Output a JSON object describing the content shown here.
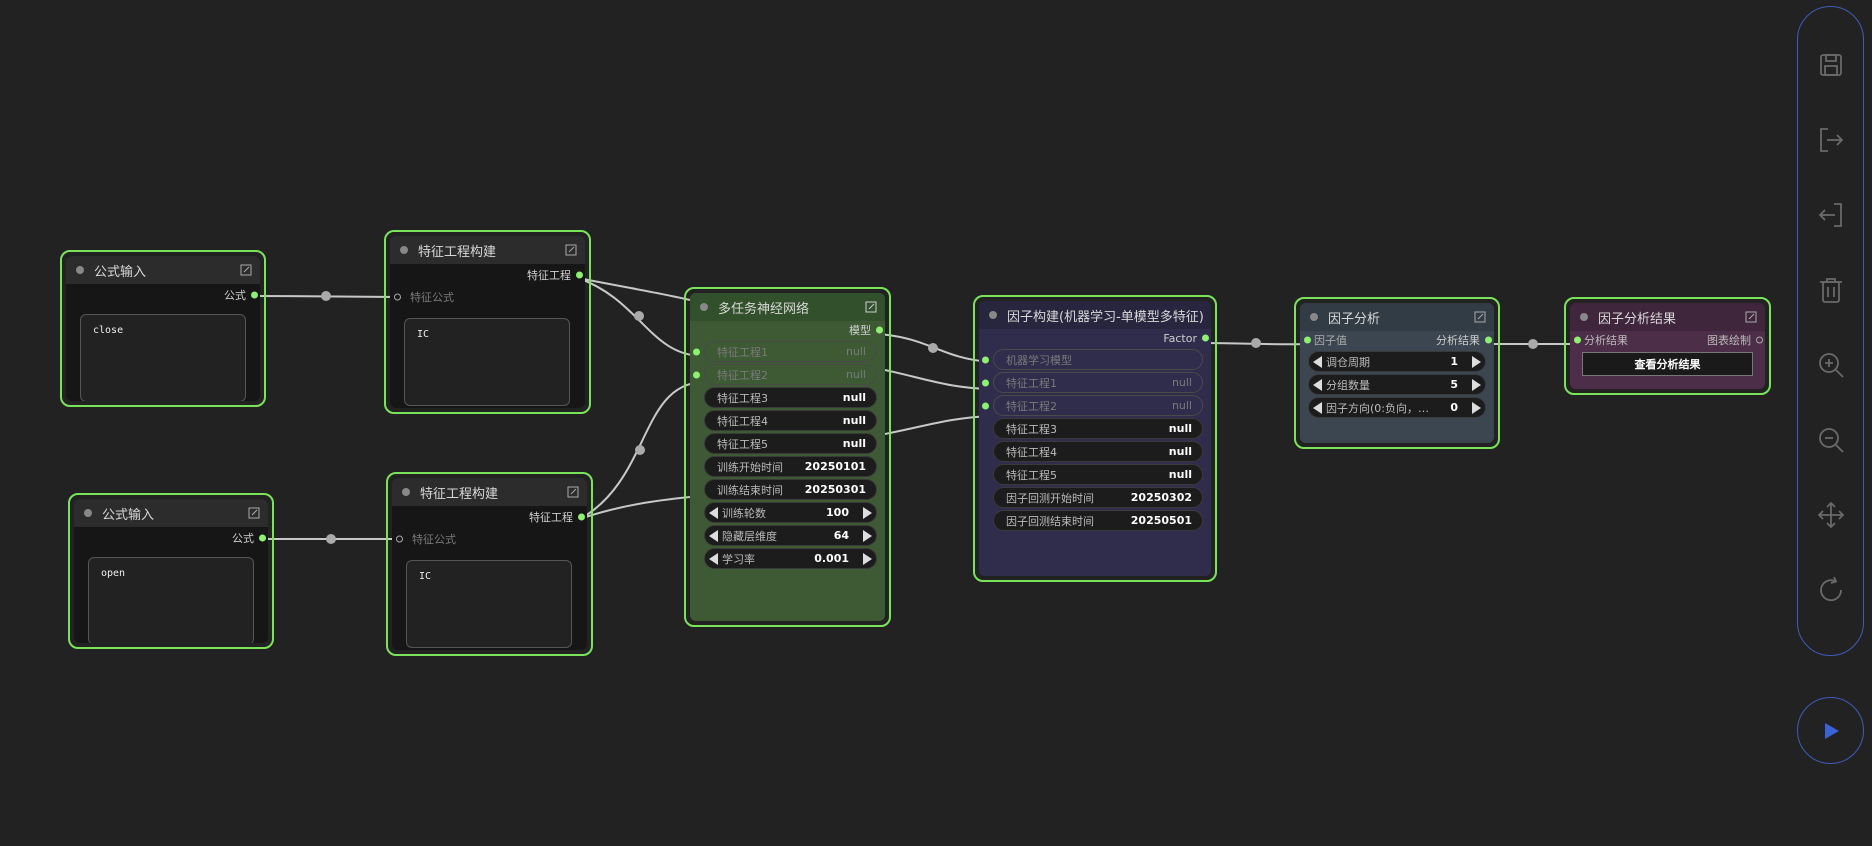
{
  "nodes": {
    "formula_input_1": {
      "title": "公式输入",
      "out_label": "公式",
      "code": "close"
    },
    "feature_build_1": {
      "title": "特征工程构建",
      "out_label": "特征工程",
      "in_label": "特征公式",
      "code": "IC"
    },
    "formula_input_2": {
      "title": "公式输入",
      "out_label": "公式",
      "code": "open"
    },
    "feature_build_2": {
      "title": "特征工程构建",
      "out_label": "特征工程",
      "in_label": "特征公式",
      "code": "IC"
    },
    "multitask_nn": {
      "title": "多任务神经网络",
      "out_label": "模型",
      "widgets": [
        {
          "label": "特征工程1",
          "value": "null"
        },
        {
          "label": "特征工程2",
          "value": "null"
        },
        {
          "label": "特征工程3",
          "value": "null"
        },
        {
          "label": "特征工程4",
          "value": "null"
        },
        {
          "label": "特征工程5",
          "value": "null"
        },
        {
          "label": "训练开始时间",
          "value": "20250101"
        },
        {
          "label": "训练结束时间",
          "value": "20250301"
        },
        {
          "label": "训练轮数",
          "value": "100"
        },
        {
          "label": "隐藏层维度",
          "value": "64"
        },
        {
          "label": "学习率",
          "value": "0.001"
        }
      ]
    },
    "factor_build": {
      "title": "因子构建(机器学习-单模型多特征)",
      "out_label": "Factor",
      "widgets": [
        {
          "label": "机器学习模型",
          "value": ""
        },
        {
          "label": "特征工程1",
          "value": "null"
        },
        {
          "label": "特征工程2",
          "value": "null"
        },
        {
          "label": "特征工程3",
          "value": "null"
        },
        {
          "label": "特征工程4",
          "value": "null"
        },
        {
          "label": "特征工程5",
          "value": "null"
        },
        {
          "label": "因子回测开始时间",
          "value": "20250302"
        },
        {
          "label": "因子回测结束时间",
          "value": "20250501"
        }
      ]
    },
    "factor_analysis": {
      "title": "因子分析",
      "in_label": "因子值",
      "out_label": "分析结果",
      "widgets": [
        {
          "label": "调仓周期",
          "value": "1"
        },
        {
          "label": "分组数量",
          "value": "5"
        },
        {
          "label": "因子方向(0:负向，…",
          "value": "0"
        }
      ]
    },
    "factor_result": {
      "title": "因子分析结果",
      "in_label": "分析结果",
      "out_label": "图表绘制",
      "button": "查看分析结果"
    }
  },
  "colors": {
    "background": "#222222",
    "node_border": "#7be35a",
    "slot": "#8ef070",
    "nn_body": "#3d5a35",
    "factor_body": "#2f2c4c",
    "analysis_body": "#3b4650",
    "result_body": "#4c2e48",
    "toolbar_border": "#3f5bb8"
  },
  "toolbar": {
    "tools": [
      "save-icon",
      "export-icon",
      "import-icon",
      "delete-icon",
      "zoom-in-icon",
      "zoom-out-icon",
      "move-icon",
      "refresh-icon"
    ],
    "run": "play-icon"
  }
}
